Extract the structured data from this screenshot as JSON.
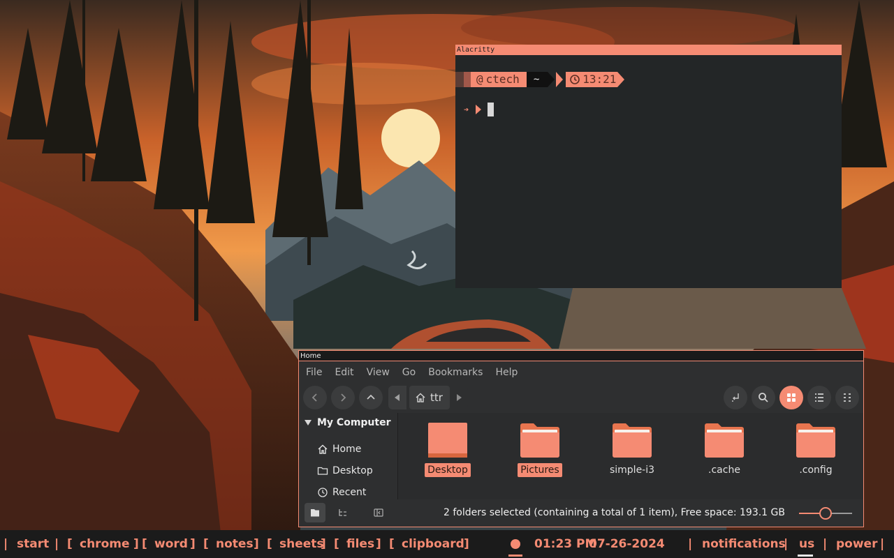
{
  "theme": {
    "accent": "#f58b73",
    "terminal_bg": "#232627",
    "fm_bg": "#2e2f30",
    "bar_bg": "#1b1b1b"
  },
  "terminal": {
    "title": "Alacritty",
    "prompt_user": "ctech",
    "prompt_dir": "~",
    "prompt_time": "13:21",
    "prompt_arrow": "➔"
  },
  "file_manager": {
    "title": "Home",
    "menu": [
      "File",
      "Edit",
      "View",
      "Go",
      "Bookmarks",
      "Help"
    ],
    "path": "ttr",
    "sidebar": {
      "section": "My Computer",
      "items": [
        "Home",
        "Desktop",
        "Recent"
      ]
    },
    "files": [
      {
        "name": "Desktop",
        "selected": true
      },
      {
        "name": "Pictures",
        "selected": true
      },
      {
        "name": "simple-i3",
        "selected": false
      },
      {
        "name": ".cache",
        "selected": false
      },
      {
        "name": ".config",
        "selected": false
      }
    ],
    "status": "2 folders selected (containing a total of 1 item), Free space: 193.1 GB",
    "zoom_fraction": 0.5
  },
  "taskbar": {
    "sep": "|",
    "workspaces": [
      "start",
      "chrome",
      "word",
      "notes",
      "sheets",
      "files",
      "clipboard"
    ],
    "time": "01:23 PM",
    "date": "07-26-2024",
    "right": [
      "notifications",
      "us",
      "power"
    ]
  }
}
